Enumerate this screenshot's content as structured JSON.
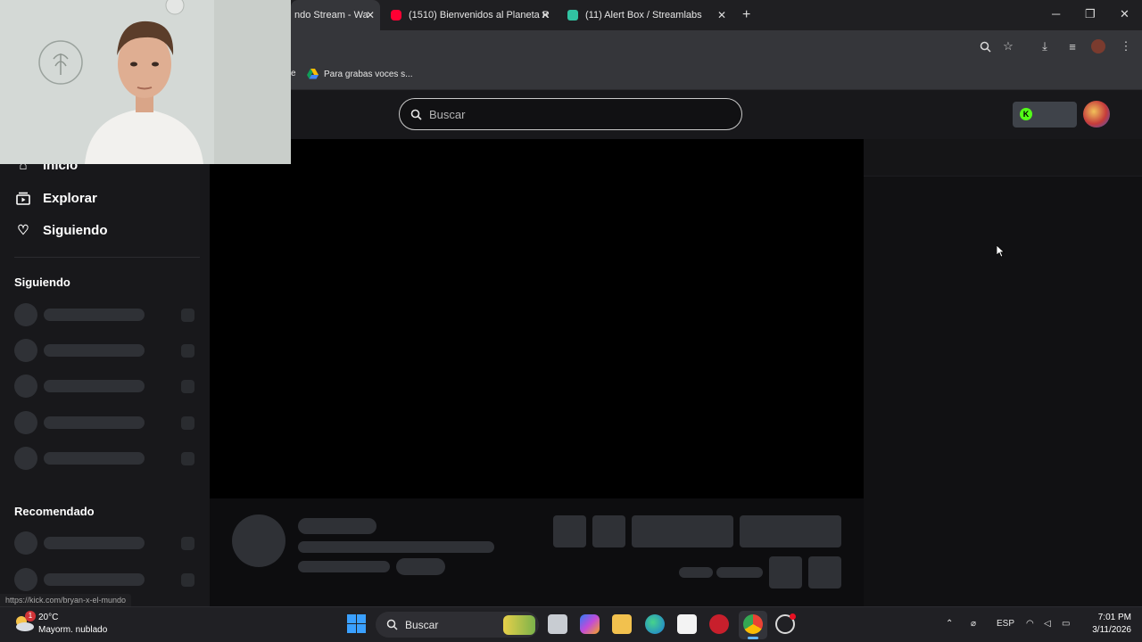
{
  "browser": {
    "tabs": [
      {
        "title": "ndo Stream - Wa",
        "active": true
      },
      {
        "title": "(1510) Bienvenidos al Planeta R",
        "active": false
      },
      {
        "title": "(11) Alert Box / Streamlabs",
        "active": false
      }
    ],
    "new_tab_icon": "plus-icon",
    "bookmarks": [
      {
        "label": "e"
      },
      {
        "label": "Para grabas voces s..."
      }
    ],
    "status_url": "https://kick.com/bryan-x-el-mundo"
  },
  "site": {
    "search_placeholder": "Buscar",
    "accent_color": "#53fc18",
    "nav": [
      {
        "label": "Inicio",
        "icon": "home-icon"
      },
      {
        "label": "Explorar",
        "icon": "browse-icon"
      },
      {
        "label": "Siguiendo",
        "icon": "heart-icon"
      }
    ],
    "sections": {
      "following": "Siguiendo",
      "recommended": "Recomendado"
    }
  },
  "taskbar": {
    "weather_temp": "20°C",
    "weather_desc": "Mayorm. nublado",
    "weather_badge": "1",
    "search_label": "Buscar",
    "language": "ESP",
    "time": "7:01 PM",
    "date": "3/11/2026"
  }
}
